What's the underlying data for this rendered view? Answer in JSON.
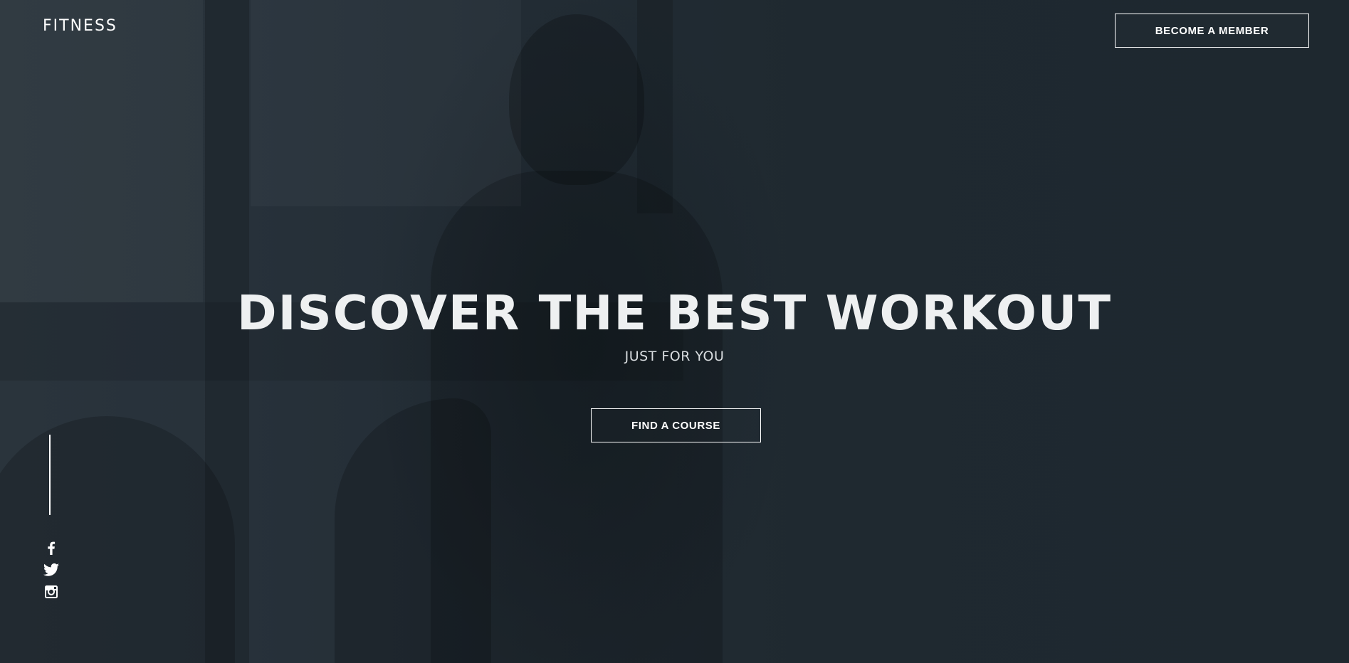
{
  "brand": {
    "logo": "FITNESS"
  },
  "header": {
    "cta_label": "BECOME A MEMBER"
  },
  "hero": {
    "headline": "DISCOVER THE BEST WORKOUT",
    "subheadline": "JUST FOR YOU",
    "cta_label": "FIND A COURSE"
  },
  "social": {
    "icons": [
      "facebook-icon",
      "twitter-icon",
      "instagram-icon"
    ]
  },
  "colors": {
    "background": "#1e272e",
    "text": "#ffffff",
    "headline": "#eef0f1"
  }
}
